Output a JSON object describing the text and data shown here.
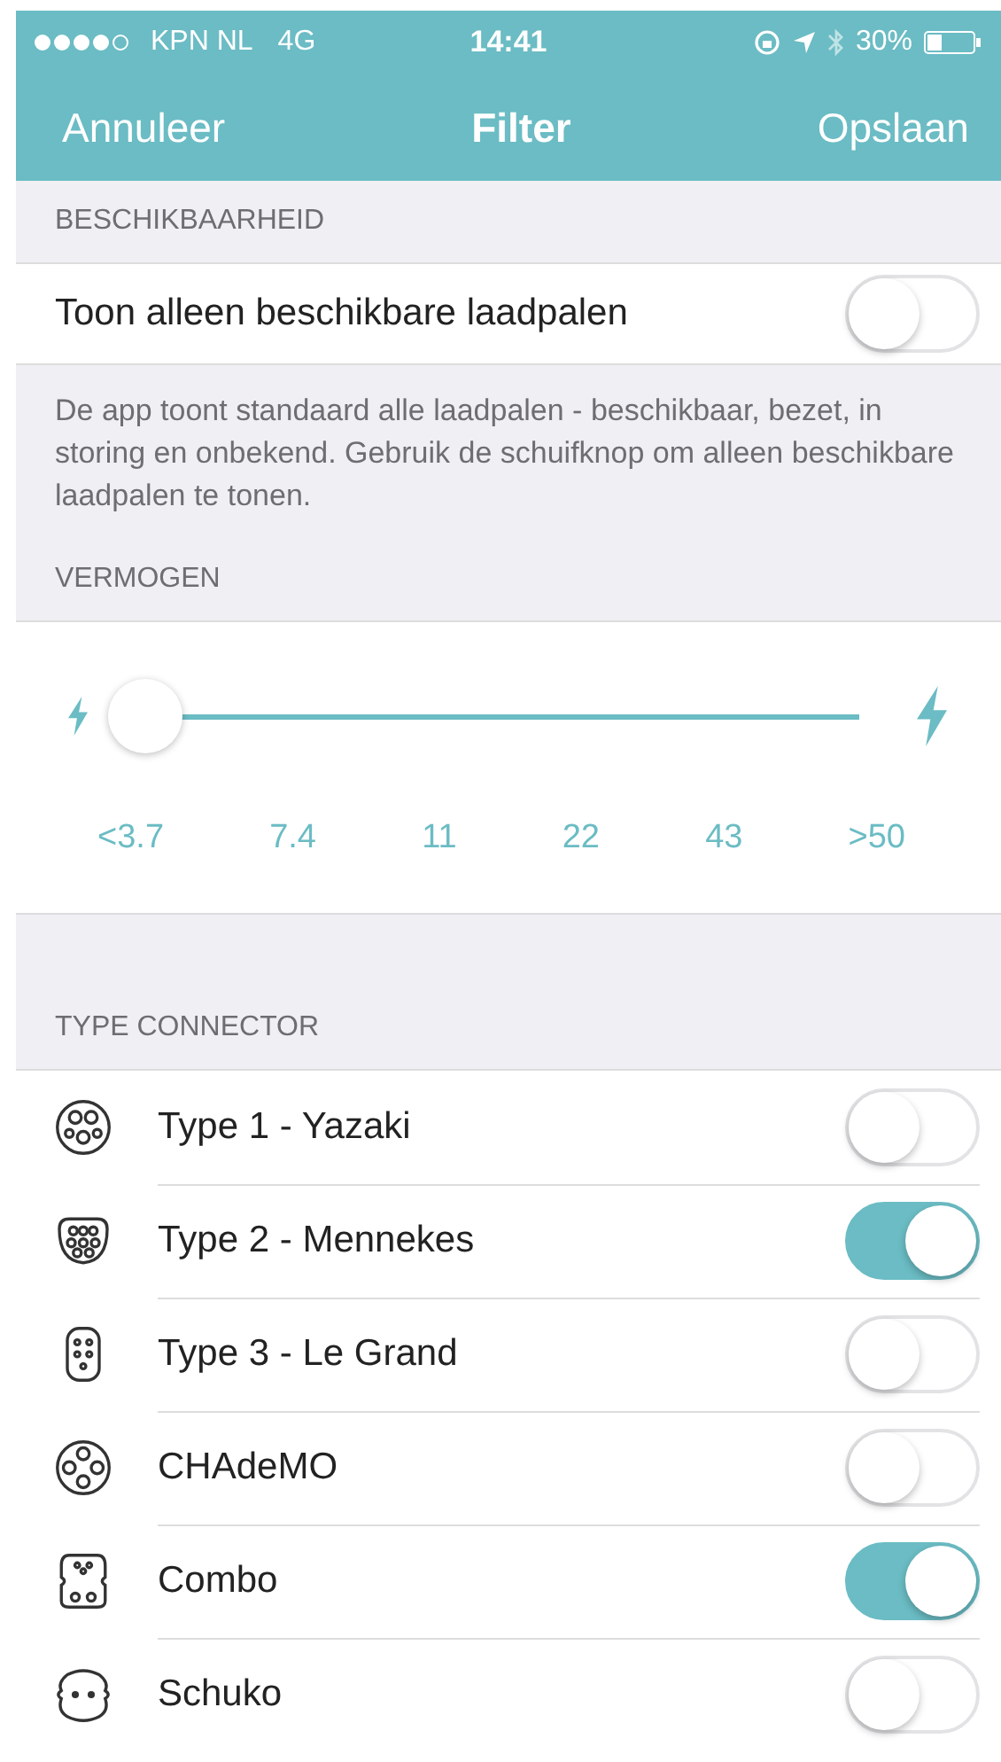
{
  "status_bar": {
    "carrier": "KPN NL",
    "network": "4G",
    "time": "14:41",
    "battery": "30%"
  },
  "nav": {
    "left": "Annuleer",
    "title": "Filter",
    "right": "Opslaan"
  },
  "availability": {
    "header": "BESCHIKBAARHEID",
    "label": "Toon alleen beschikbare laadpalen",
    "on": false,
    "description": "De app toont standaard alle laadpalen - beschikbaar, bezet, in storing en onbekend. Gebruik de schuifknop om alleen beschikbare laadpalen te tonen."
  },
  "power": {
    "header": "VERMOGEN",
    "level": 0,
    "ticks": [
      "<3.7",
      "7.4",
      "11",
      "22",
      "43",
      ">50"
    ]
  },
  "connectors": {
    "header": "TYPE CONNECTOR",
    "items": [
      {
        "kind": "type1",
        "label": "Type 1 - Yazaki",
        "on": false
      },
      {
        "kind": "type2",
        "label": "Type 2 - Mennekes",
        "on": true
      },
      {
        "kind": "type3",
        "label": "Type 3 - Le Grand",
        "on": false
      },
      {
        "kind": "chademo",
        "label": "CHAdeMO",
        "on": false
      },
      {
        "kind": "combo",
        "label": "Combo",
        "on": true
      },
      {
        "kind": "schuko",
        "label": "Schuko",
        "on": false
      }
    ]
  }
}
